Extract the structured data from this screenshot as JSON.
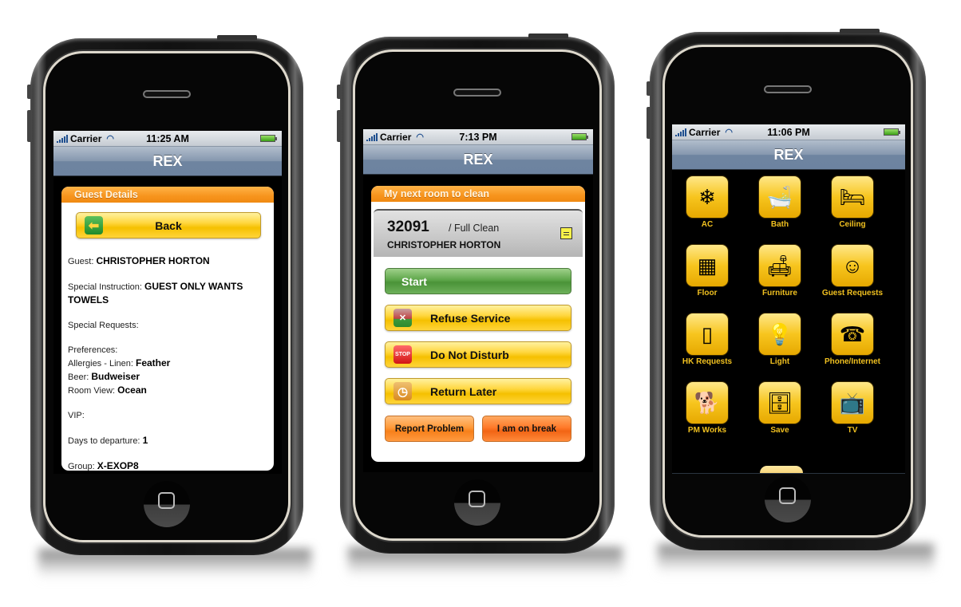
{
  "status_bar": {
    "carrier": "Carrier",
    "phones": [
      {
        "time": "11:25 AM"
      },
      {
        "time": "7:13 PM"
      },
      {
        "time": "11:06 PM"
      }
    ]
  },
  "app": {
    "title": "REX"
  },
  "phone1": {
    "panel_title": "Guest Details",
    "back_label": "Back",
    "fields": [
      {
        "label": "Guest:",
        "value": "CHRISTOPHER HORTON"
      },
      {
        "label": "Special Instruction:",
        "value": "GUEST ONLY WANTS TOWELS"
      },
      {
        "label": "Special Requests:",
        "value": ""
      },
      {
        "label": "Preferences:",
        "value": ""
      },
      {
        "label": "Allergies - Linen:",
        "value": "Feather"
      },
      {
        "label": "Beer:",
        "value": "Budweiser"
      },
      {
        "label": "Room View:",
        "value": "Ocean"
      },
      {
        "label": "VIP:",
        "value": ""
      },
      {
        "label": "Days to departure:",
        "value": "1"
      },
      {
        "label": "Group:",
        "value": "X-EXOP8"
      }
    ]
  },
  "phone2": {
    "panel_title": "My next room to clean",
    "room_number": "32091",
    "clean_type": "/ Full Clean",
    "guest_name": "CHRISTOPHER HORTON",
    "start_label": "Start",
    "actions": [
      {
        "label": "Refuse Service",
        "icon": "refuse-icon"
      },
      {
        "label": "Do Not Disturb",
        "icon": "stop-icon"
      },
      {
        "label": "Return Later",
        "icon": "clock-icon"
      }
    ],
    "report_label": "Report Problem",
    "break_label": "I am on break"
  },
  "phone3": {
    "categories": [
      {
        "label": "AC",
        "icon": "air-conditioner-icon",
        "glyph": "❄"
      },
      {
        "label": "Bath",
        "icon": "bathtub-icon",
        "glyph": "🛁"
      },
      {
        "label": "Ceiling",
        "icon": "bedroom-icon",
        "glyph": "🛏"
      },
      {
        "label": "Floor",
        "icon": "floor-icon",
        "glyph": "▦"
      },
      {
        "label": "Furniture",
        "icon": "armchair-icon",
        "glyph": "🛋"
      },
      {
        "label": "Guest Requests",
        "icon": "guest-icon",
        "glyph": "☺"
      },
      {
        "label": "HK Requests",
        "icon": "housekeeping-icon",
        "glyph": "▯"
      },
      {
        "label": "Light",
        "icon": "light-icon",
        "glyph": "💡"
      },
      {
        "label": "Phone/Internet",
        "icon": "telephone-icon",
        "glyph": "☎"
      },
      {
        "label": "PM Works",
        "icon": "dog-icon",
        "glyph": "🐕"
      },
      {
        "label": "Save",
        "icon": "safe-icon",
        "glyph": "🗄"
      },
      {
        "label": "TV",
        "icon": "television-icon",
        "glyph": "📺"
      }
    ]
  },
  "colors": {
    "accent_orange": "#f7941d",
    "button_yellow": "#ffd740",
    "start_green": "#5ea64a",
    "navbar_blue": "#8597ae",
    "tile_label_gold": "#f0c020"
  }
}
